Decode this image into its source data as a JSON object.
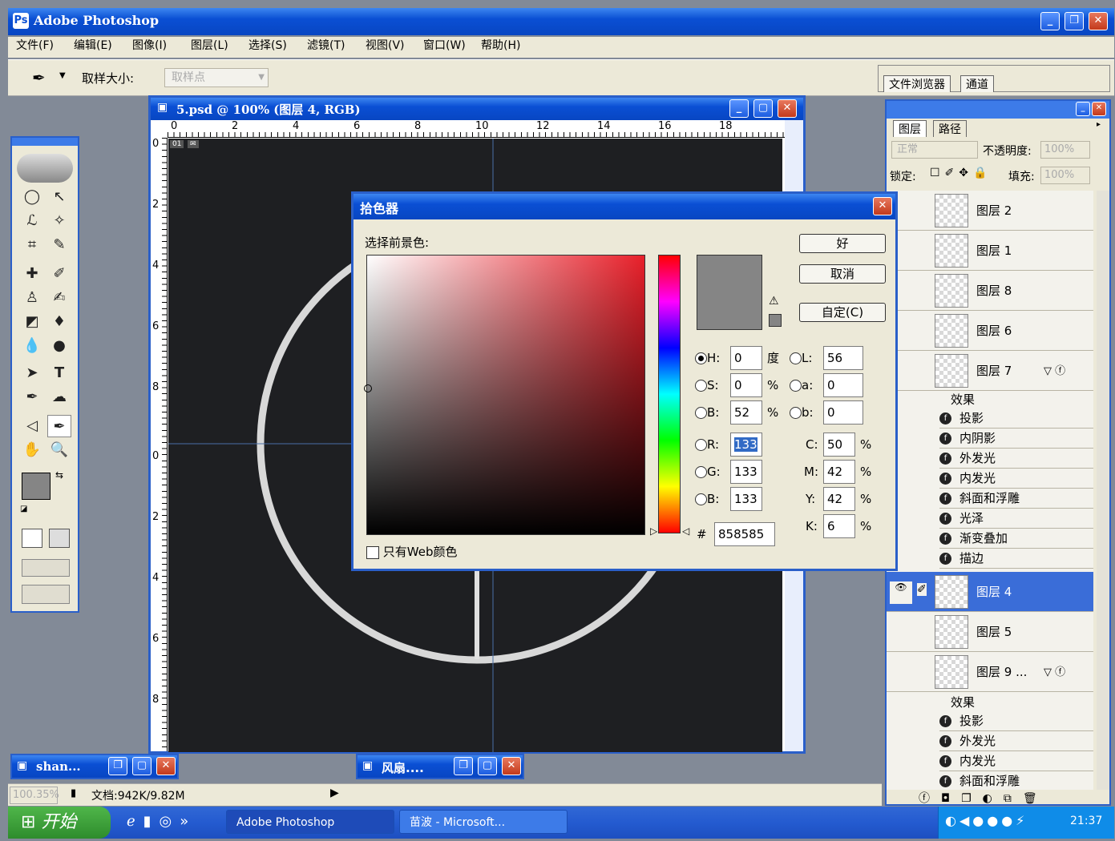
{
  "app": {
    "title": "Adobe Photoshop"
  },
  "menu": [
    "文件(F)",
    "编辑(E)",
    "图像(I)",
    "图层(L)",
    "选择(S)",
    "滤镜(T)",
    "视图(V)",
    "窗口(W)",
    "帮助(H)"
  ],
  "options_bar": {
    "sample_size_label": "取样大小:",
    "sample_size_value": "取样点"
  },
  "palette_well": {
    "tabs": [
      "文件浏览器",
      "通道"
    ]
  },
  "document": {
    "title": "5.psd @ 100% (图层 4, RGB)",
    "ruler_h": [
      "0",
      "2",
      "4",
      "6",
      "8",
      "10",
      "12",
      "14",
      "16",
      "18"
    ],
    "ruler_v": [
      "0",
      "2",
      "4",
      "6",
      "8",
      "0",
      "2",
      "4",
      "6",
      "8"
    ],
    "tabs": [
      "01",
      "✉"
    ]
  },
  "color_picker": {
    "title": "拾色器",
    "prompt": "选择前景色:",
    "ok": "好",
    "cancel": "取消",
    "custom": "自定(C)",
    "hsb": {
      "H": "0",
      "S": "0",
      "B": "52",
      "H_unit": "度",
      "S_unit": "%",
      "B_unit": "%"
    },
    "lab": {
      "L": "56",
      "a": "0",
      "b": "0"
    },
    "rgb": {
      "R": "133",
      "G": "133",
      "B": "133"
    },
    "cmyk": {
      "C": "50",
      "M": "42",
      "Y": "42",
      "K": "6",
      "unit": "%"
    },
    "hex_label": "#",
    "hex": "858585",
    "web_only": "只有Web颜色",
    "labels": {
      "H": "H:",
      "S": "S:",
      "Bv": "B:",
      "L": "L:",
      "a": "a:",
      "b": "b:",
      "R": "R:",
      "G": "G:",
      "Bc": "B:",
      "C": "C:",
      "M": "M:",
      "Y": "Y:",
      "K": "K:"
    },
    "new_color": "#858585"
  },
  "layers_panel": {
    "tabs": [
      "图层",
      "路径"
    ],
    "blend_mode": "正常",
    "opacity_label": "不透明度:",
    "opacity": "100%",
    "lock_label": "锁定:",
    "fill_label": "填充:",
    "fill": "100%",
    "layers": [
      "图层 2",
      "图层 1",
      "图层 8",
      "图层 6",
      "图层 7"
    ],
    "effects_label": "效果",
    "layer7_effects": [
      "投影",
      "内阴影",
      "外发光",
      "内发光",
      "斜面和浮雕",
      "光泽",
      "渐变叠加",
      "描边"
    ],
    "layers_b": [
      "图层 4",
      "图层 5",
      "图层 9 ..."
    ],
    "layer9_effects": [
      "投影",
      "外发光",
      "内发光",
      "斜面和浮雕"
    ]
  },
  "minimized": [
    "shan...",
    "风扇...."
  ],
  "status": {
    "zoom": "100.35%",
    "doc": "文档:942K/9.82M"
  },
  "taskbar": {
    "start": "开始",
    "items": [
      "Adobe Photoshop",
      "苗波 - Microsoft..."
    ],
    "clock": "21:37"
  }
}
